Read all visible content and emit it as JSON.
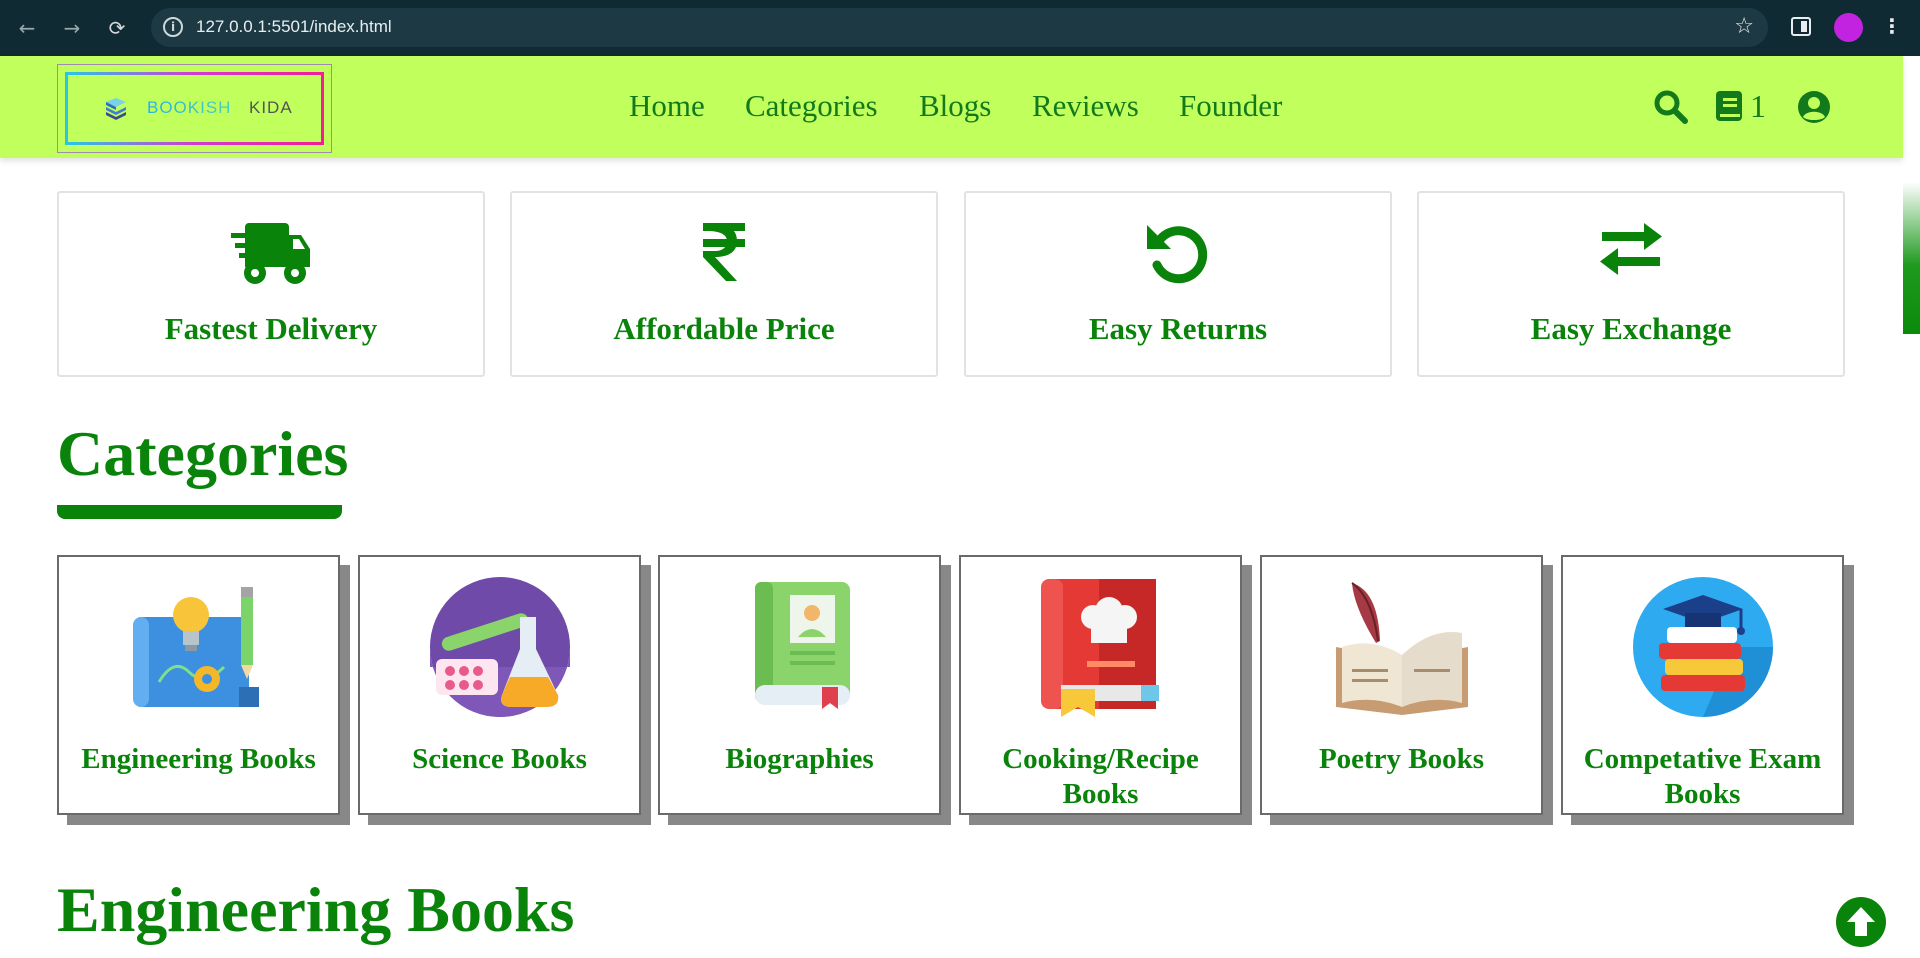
{
  "browser": {
    "url": "127.0.0.1:5501/index.html",
    "back_icon": "←",
    "forward_icon": "→",
    "reload_icon": "⟳",
    "info_icon": "i",
    "star_icon": "☆",
    "menu_icon": "⋮"
  },
  "header": {
    "logo_text_1": "BOOKISH",
    "logo_text_2": "KIDA",
    "nav": [
      "Home",
      "Categories",
      "Blogs",
      "Reviews",
      "Founder"
    ],
    "cart_count": "1"
  },
  "features": [
    {
      "label": "Fastest Delivery",
      "icon": "truck-fast-icon"
    },
    {
      "label": "Affordable Price",
      "icon": "rupee-icon"
    },
    {
      "label": "Easy Returns",
      "icon": "rotate-left-icon"
    },
    {
      "label": "Easy Exchange",
      "icon": "arrows-exchange-icon"
    }
  ],
  "categories_title": "Categories",
  "categories": [
    {
      "label": "Engineering Books",
      "icon": "engineering-blueprint-icon"
    },
    {
      "label": "Science Books",
      "icon": "science-flask-icon"
    },
    {
      "label": "Biographies",
      "icon": "biography-book-icon"
    },
    {
      "label": "Cooking/Recipe Books",
      "icon": "chef-recipe-book-icon"
    },
    {
      "label": "Poetry Books",
      "icon": "poetry-feather-book-icon"
    },
    {
      "label": "Competative Exam Books",
      "icon": "graduation-books-icon"
    }
  ],
  "next_section_title": "Engineering Books",
  "colors": {
    "header_bg": "#c1ff5c",
    "brand_green": "#098309",
    "nav_green": "#127a1b"
  }
}
